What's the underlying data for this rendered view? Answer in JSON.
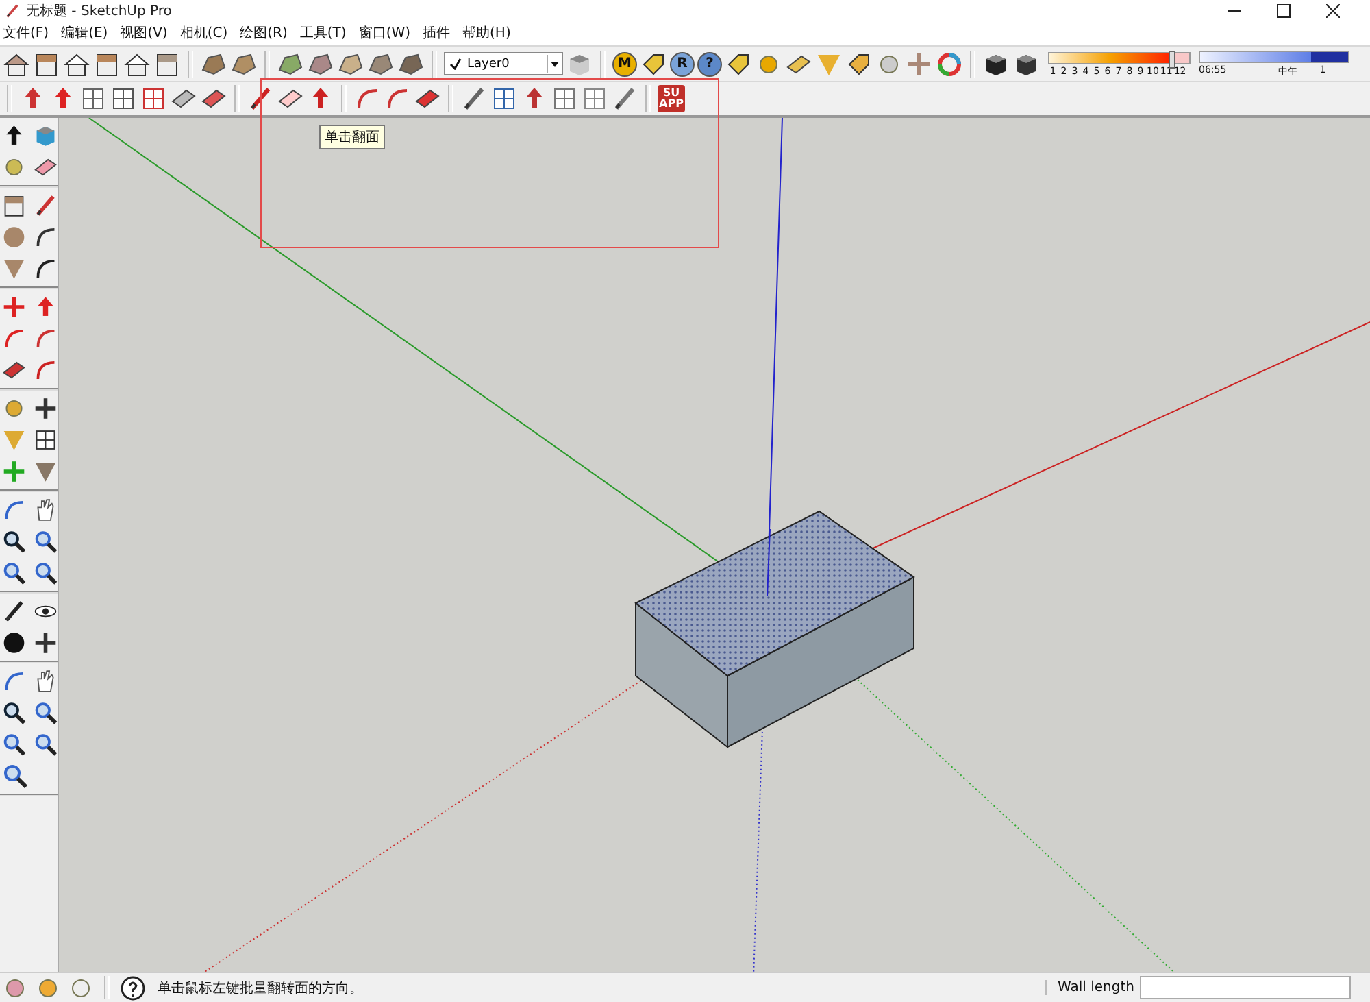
{
  "window": {
    "title": "无标题 - SketchUp Pro"
  },
  "menu": [
    "文件(F)",
    "编辑(E)",
    "视图(V)",
    "相机(C)",
    "绘图(R)",
    "工具(T)",
    "窗口(W)",
    "插件",
    "帮助(H)"
  ],
  "toolbar_top": {
    "layer": {
      "checked": true,
      "value": "Layer0"
    },
    "badge_labels": [
      "M",
      "R",
      "?"
    ],
    "month_slider": {
      "labels": [
        "1",
        "2",
        "3",
        "4",
        "5",
        "6",
        "7",
        "8",
        "9",
        "10",
        "11",
        "12"
      ],
      "level": 0.87
    },
    "time_slider": {
      "start": "06:55",
      "middle": "中午",
      "end": "1",
      "level": 0.75
    }
  },
  "toolbar_second": {
    "app_label": [
      "SU",
      "APP"
    ]
  },
  "tooltip": "单击翻面",
  "status_bar": {
    "hint": "单击鼠标左键批量翻转面的方向。",
    "measure_label": "Wall length"
  }
}
